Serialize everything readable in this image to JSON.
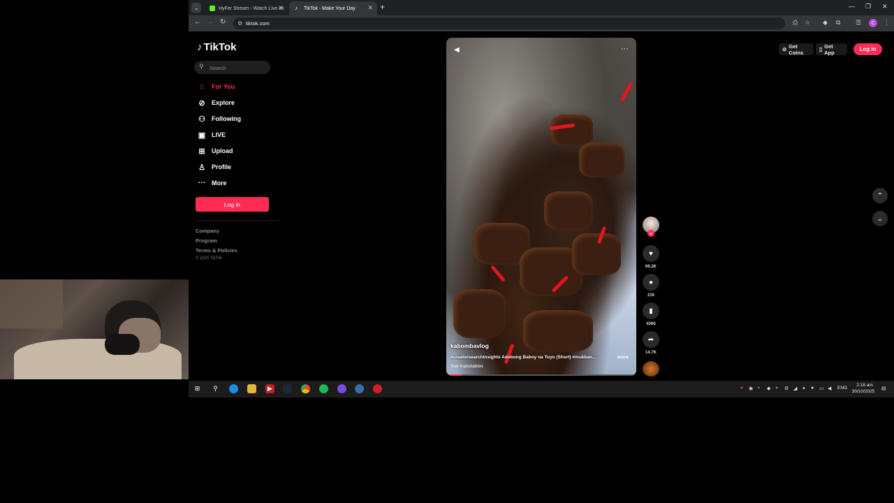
{
  "browser": {
    "tabs": [
      {
        "label": "HyFer Stream - Watch Live on",
        "favicon_color": "#53fc18"
      },
      {
        "label": "TikTok - Make Your Day",
        "favicon_color": "#ffffff"
      }
    ],
    "new_tab_label": "+",
    "url": "tiktok.com"
  },
  "sidebar": {
    "logo_text": "TikTok",
    "search_placeholder": "Search",
    "nav": [
      {
        "label": "For You",
        "icon": "home-icon"
      },
      {
        "label": "Explore",
        "icon": "compass-icon"
      },
      {
        "label": "Following",
        "icon": "following-icon"
      },
      {
        "label": "LIVE",
        "icon": "live-icon"
      },
      {
        "label": "Upload",
        "icon": "upload-icon"
      },
      {
        "label": "Profile",
        "icon": "profile-icon"
      },
      {
        "label": "More",
        "icon": "more-icon"
      }
    ],
    "login_label": "Log in",
    "footer": [
      "Company",
      "Program",
      "Terms & Policies"
    ],
    "copyright": "© 2025 TikTok"
  },
  "header": {
    "get_coins": "Get Coins",
    "get_app": "Get App",
    "login": "Log in"
  },
  "video": {
    "author": "kabombavlog",
    "caption": "#creatorsearchinsights Adobong Baboy na Tuyo (Short) #mukban...",
    "more_label": "more",
    "see_translation": "See translation",
    "progress": 0.08
  },
  "actions": {
    "likes": "69.2K",
    "comments": "216",
    "saves": "4366",
    "shares": "14.7K"
  },
  "taskbar": {
    "lang": "ENG",
    "time": "2:18 am",
    "date": "30/10/2025"
  },
  "colors": {
    "accent": "#fe2c55",
    "background": "#000000"
  }
}
